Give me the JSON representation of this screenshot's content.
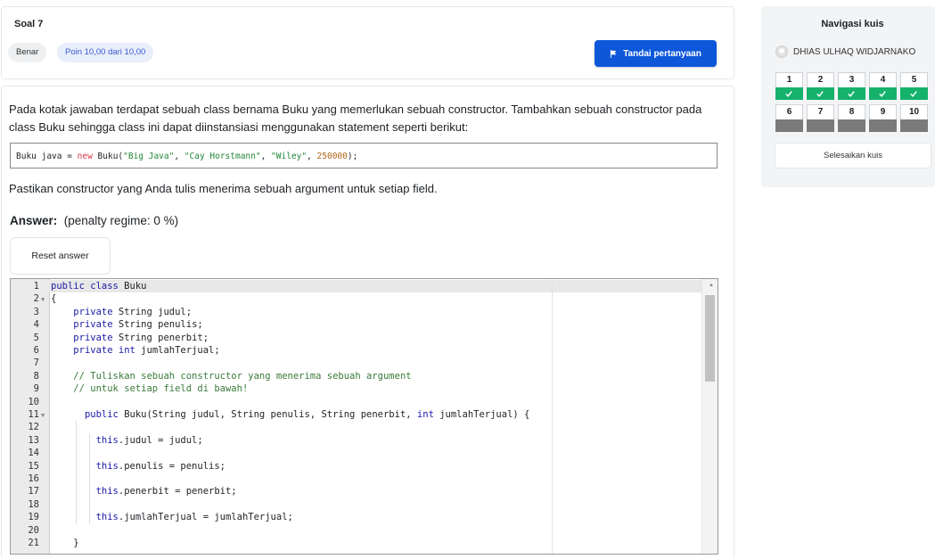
{
  "question": {
    "title": "Soal 7",
    "status": "Benar",
    "points": "Poin 10,00 dari 10,00",
    "flag_label": "Tandai pertanyaan",
    "text": "Pada kotak jawaban terdapat sebuah class bernama Buku yang memerlukan sebuah constructor. Tambahkan sebuah constructor pada class Buku sehingga class ini dapat diinstansiasi menggunakan statement seperti berikut:",
    "code_sample": {
      "prefix": "Buku java = ",
      "new_kw": "new",
      "call": " Buku(",
      "arg1": "\"Big Java\"",
      "sep1": ", ",
      "arg2": "\"Cay Horstmann\"",
      "sep2": ", ",
      "arg3": "\"Wiley\"",
      "sep3": ", ",
      "arg4": "250000",
      "suffix": ");"
    },
    "note": "Pastikan constructor yang Anda tulis menerima sebuah argument untuk setiap field.",
    "answer_label": "Answer:",
    "penalty": "(penalty regime: 0 %)",
    "reset_label": "Reset answer"
  },
  "editor": {
    "line_numbers": [
      "1",
      "2",
      "3",
      "4",
      "5",
      "6",
      "7",
      "8",
      "9",
      "10",
      "11",
      "12",
      "13",
      "14",
      "15",
      "16",
      "17",
      "18",
      "19",
      "20",
      "21"
    ],
    "fold_lines": [
      "2",
      "11"
    ],
    "lines": [
      {
        "indent": "",
        "parts": [
          {
            "t": "k",
            "v": "public class"
          },
          {
            "t": "p",
            "v": " Buku"
          }
        ]
      },
      {
        "indent": "",
        "parts": [
          {
            "t": "p",
            "v": "{"
          }
        ]
      },
      {
        "indent": "    ",
        "parts": [
          {
            "t": "k",
            "v": "private"
          },
          {
            "t": "p",
            "v": " String judul;"
          }
        ]
      },
      {
        "indent": "    ",
        "parts": [
          {
            "t": "k",
            "v": "private"
          },
          {
            "t": "p",
            "v": " String penulis;"
          }
        ]
      },
      {
        "indent": "    ",
        "parts": [
          {
            "t": "k",
            "v": "private"
          },
          {
            "t": "p",
            "v": " String penerbit;"
          }
        ]
      },
      {
        "indent": "    ",
        "parts": [
          {
            "t": "k",
            "v": "private"
          },
          {
            "t": "p",
            "v": " "
          },
          {
            "t": "k",
            "v": "int"
          },
          {
            "t": "p",
            "v": " jumlahTerjual;"
          }
        ]
      },
      {
        "indent": "",
        "parts": []
      },
      {
        "indent": "    ",
        "parts": [
          {
            "t": "c",
            "v": "// Tuliskan sebuah constructor yang menerima sebuah argument"
          }
        ]
      },
      {
        "indent": "    ",
        "parts": [
          {
            "t": "c",
            "v": "// untuk setiap field di bawah!"
          }
        ]
      },
      {
        "indent": "",
        "parts": []
      },
      {
        "indent": "      ",
        "parts": [
          {
            "t": "k",
            "v": "public"
          },
          {
            "t": "p",
            "v": " Buku(String judul, String penulis, String penerbit, "
          },
          {
            "t": "k",
            "v": "int"
          },
          {
            "t": "p",
            "v": " jumlahTerjual) {"
          }
        ]
      },
      {
        "indent": "",
        "parts": []
      },
      {
        "indent": "        ",
        "parts": [
          {
            "t": "k",
            "v": "this"
          },
          {
            "t": "p",
            "v": ".judul = judul;"
          }
        ]
      },
      {
        "indent": "",
        "parts": []
      },
      {
        "indent": "        ",
        "parts": [
          {
            "t": "k",
            "v": "this"
          },
          {
            "t": "p",
            "v": ".penulis = penulis;"
          }
        ]
      },
      {
        "indent": "",
        "parts": []
      },
      {
        "indent": "        ",
        "parts": [
          {
            "t": "k",
            "v": "this"
          },
          {
            "t": "p",
            "v": ".penerbit = penerbit;"
          }
        ]
      },
      {
        "indent": "",
        "parts": []
      },
      {
        "indent": "        ",
        "parts": [
          {
            "t": "k",
            "v": "this"
          },
          {
            "t": "p",
            "v": ".jumlahTerjual = jumlahTerjual;"
          }
        ]
      },
      {
        "indent": "",
        "parts": []
      },
      {
        "indent": "    ",
        "parts": [
          {
            "t": "p",
            "v": "}"
          }
        ]
      }
    ]
  },
  "nav": {
    "title": "Navigasi kuis",
    "user_name": "DHIAS ULHAQ WIDJARNAKO",
    "questions": [
      {
        "label": "1",
        "state": "done"
      },
      {
        "label": "2",
        "state": "done"
      },
      {
        "label": "3",
        "state": "done"
      },
      {
        "label": "4",
        "state": "done"
      },
      {
        "label": "5",
        "state": "done"
      },
      {
        "label": "6",
        "state": "todo"
      },
      {
        "label": "7",
        "state": "todo"
      },
      {
        "label": "8",
        "state": "todo"
      },
      {
        "label": "9",
        "state": "todo"
      },
      {
        "label": "10",
        "state": "todo"
      }
    ],
    "finish_label": "Selesaikan kuis"
  },
  "colors": {
    "primary": "#0f57d9",
    "correct": "#15b26b",
    "unanswered": "#7a7a7a"
  }
}
